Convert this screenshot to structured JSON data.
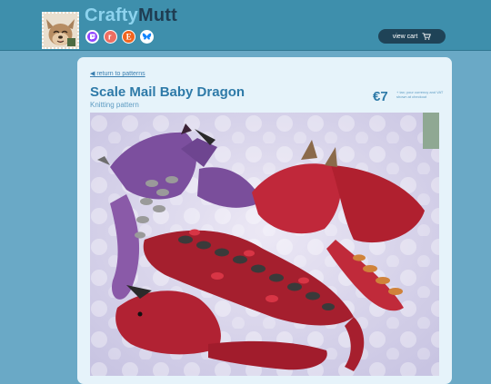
{
  "header": {
    "brand_part1": "Crafty",
    "brand_part2": "Mutt",
    "cart_label": "view cart",
    "socials": [
      {
        "icon": "twitch-icon",
        "color": "#9146ff"
      },
      {
        "icon": "ravelry-icon",
        "color": "#ee6e62"
      },
      {
        "icon": "etsy-icon",
        "color": "#f1641e"
      },
      {
        "icon": "bluesky-icon",
        "color": "#1185fe"
      }
    ]
  },
  "product": {
    "back_link": "◀ return to patterns",
    "title": "Scale Mail Baby Dragon",
    "subtitle": "Knitting pattern",
    "price": "€7",
    "price_note": "+ tax; your currency and VAT shown at checkout",
    "photo_subject": "knitted scale mail baby dragons"
  },
  "colors": {
    "topbar": "#3e8fac",
    "page_bg": "#6aa9c6",
    "card_bg": "#e6f3fa",
    "accent": "#2e7aa8",
    "brand_light": "#8dd3ee",
    "brand_dark": "#1f3d52",
    "cart_button": "#1f4357"
  }
}
